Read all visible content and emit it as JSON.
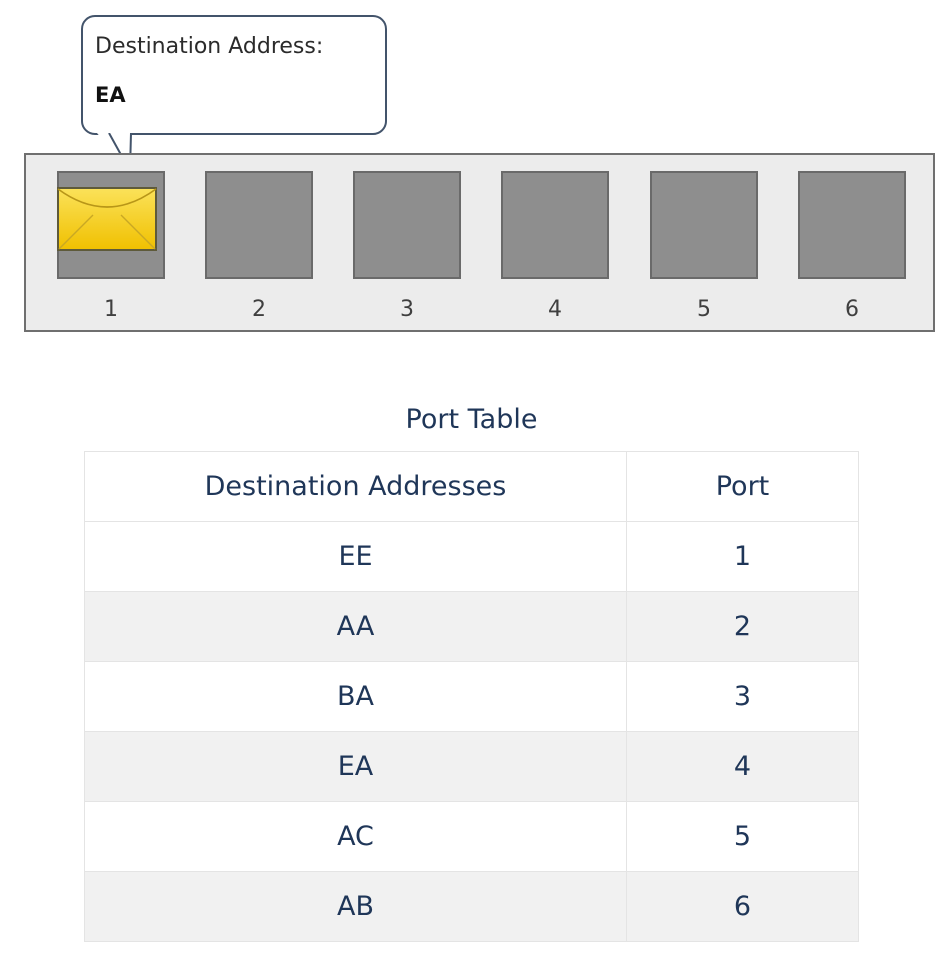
{
  "callout": {
    "label": "Destination Address:",
    "value": "EA"
  },
  "switch": {
    "ports": [
      {
        "number": "1",
        "has_frame": true
      },
      {
        "number": "2",
        "has_frame": false
      },
      {
        "number": "3",
        "has_frame": false
      },
      {
        "number": "4",
        "has_frame": false
      },
      {
        "number": "5",
        "has_frame": false
      },
      {
        "number": "6",
        "has_frame": false
      }
    ],
    "frame_icon": "envelope-icon",
    "frame_color": "#f5cf1f"
  },
  "port_table": {
    "caption": "Port Table",
    "headers": [
      "Destination Addresses",
      "Port"
    ],
    "rows": [
      {
        "address": "EE",
        "port": "1"
      },
      {
        "address": "AA",
        "port": "2"
      },
      {
        "address": "BA",
        "port": "3"
      },
      {
        "address": "EA",
        "port": "4"
      },
      {
        "address": "AC",
        "port": "5"
      },
      {
        "address": "AB",
        "port": "6"
      }
    ]
  },
  "colors": {
    "table_text": "#1f3658",
    "callout_border": "#43546b",
    "port_fill": "#8e8e8e",
    "panel_fill": "#ececec"
  }
}
